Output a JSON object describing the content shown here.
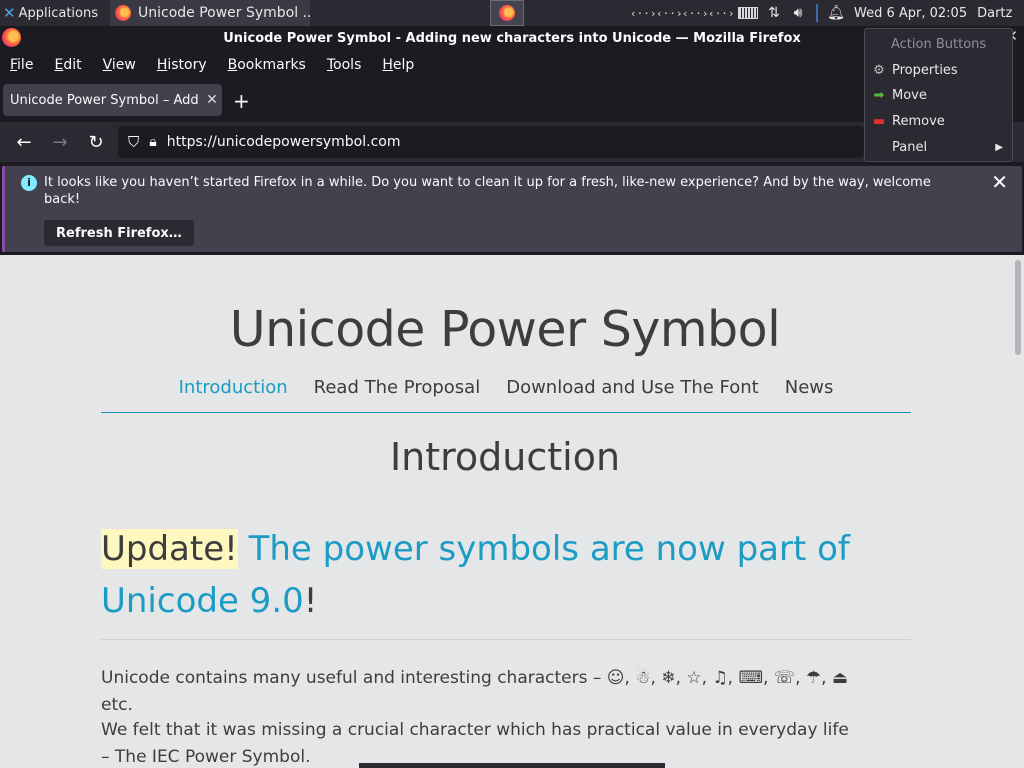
{
  "taskbar": {
    "apps_label": "Applications",
    "task_label": "Unicode Power Symbol ...",
    "net_icons": [
      "‹··›",
      "‹··›",
      "‹··›",
      "‹··›"
    ],
    "datetime": "Wed  6 Apr, 02:05",
    "user": "Dartz"
  },
  "window": {
    "title": "Unicode Power Symbol - Adding new characters into Unicode — Mozilla Firefox"
  },
  "menubar": {
    "items": [
      {
        "label": "File",
        "key": "F",
        "rest": "ile"
      },
      {
        "label": "Edit",
        "key": "E",
        "rest": "dit"
      },
      {
        "label": "View",
        "key": "V",
        "rest": "iew"
      },
      {
        "label": "History",
        "key": "H",
        "rest": "istory"
      },
      {
        "label": "Bookmarks",
        "key": "B",
        "rest": "ookmarks"
      },
      {
        "label": "Tools",
        "key": "T",
        "rest": "ools"
      },
      {
        "label": "Help",
        "key": "H",
        "rest": "elp"
      }
    ]
  },
  "tabs": [
    {
      "title": "Unicode Power Symbol – Add"
    }
  ],
  "navbar": {
    "url": "https://unicodepowersymbol.com"
  },
  "infobar": {
    "message": "It looks like you haven’t started Firefox in a while. Do you want to clean it up for a fresh, like-new experience? And by the way, welcome back!",
    "button_label": "Refresh Firefox…"
  },
  "page": {
    "title": "Unicode Power Symbol",
    "nav": [
      "Introduction",
      "Read The Proposal",
      "Download and Use The Font",
      "News"
    ],
    "active_nav": "Introduction",
    "section_heading": "Introduction",
    "update_word": "Update!",
    "update_link": "The power symbols are now part of Unicode 9.0",
    "update_tail": "!",
    "para1": "Unicode contains many useful and interesting characters – ☺, ☃, ❄, ☆, ♫, ⌨, ☏, ☂, ⏏ etc.",
    "para2": "We felt that it was missing a crucial character which has practical value in everyday life – The IEC Power Symbol."
  },
  "context_menu": {
    "header": "Action Buttons",
    "items": [
      {
        "label": "Properties",
        "icon": "gear-icon"
      },
      {
        "label": "Move",
        "icon": "arrow-right-icon"
      },
      {
        "label": "Remove",
        "icon": "remove-icon"
      },
      {
        "label": "Panel",
        "icon": "none",
        "submenu": true
      }
    ]
  },
  "colors": {
    "accent_link": "#1a9cc4",
    "page_bg": "#e4e6e8",
    "highlight": "#fff7c0",
    "chrome_dark": "#1c1b22"
  }
}
